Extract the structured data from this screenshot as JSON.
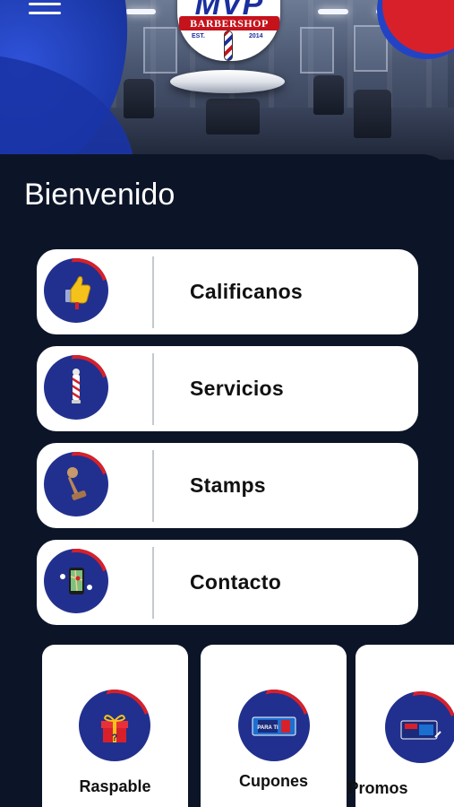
{
  "header": {
    "menu_icon": "hamburger-menu-icon",
    "logo": {
      "brand": "MVP",
      "subtitle": "BARBERSHOP",
      "est_label": "EST.",
      "est_year": "2014"
    }
  },
  "welcome_text": "Bienvenido",
  "menu": [
    {
      "label": "Calificanos",
      "icon": "thumbs-up-icon"
    },
    {
      "label": "Servicios",
      "icon": "barber-pole-icon"
    },
    {
      "label": "Stamps",
      "icon": "stamp-icon"
    },
    {
      "label": "Contacto",
      "icon": "phone-map-icon"
    }
  ],
  "tiles": [
    {
      "label": "Raspable",
      "icon": "gift-box-icon"
    },
    {
      "label": "Cupones",
      "icon": "coupon-ticket-icon",
      "ticket_text": "PARA TI"
    },
    {
      "label": "Promos",
      "icon": "promo-ticket-icon"
    }
  ],
  "colors": {
    "background": "#0c1528",
    "card": "#ffffff",
    "brand_blue": "#21308e",
    "brand_red": "#d8202a",
    "text_dark": "#111111",
    "text_light": "#ffffff"
  }
}
